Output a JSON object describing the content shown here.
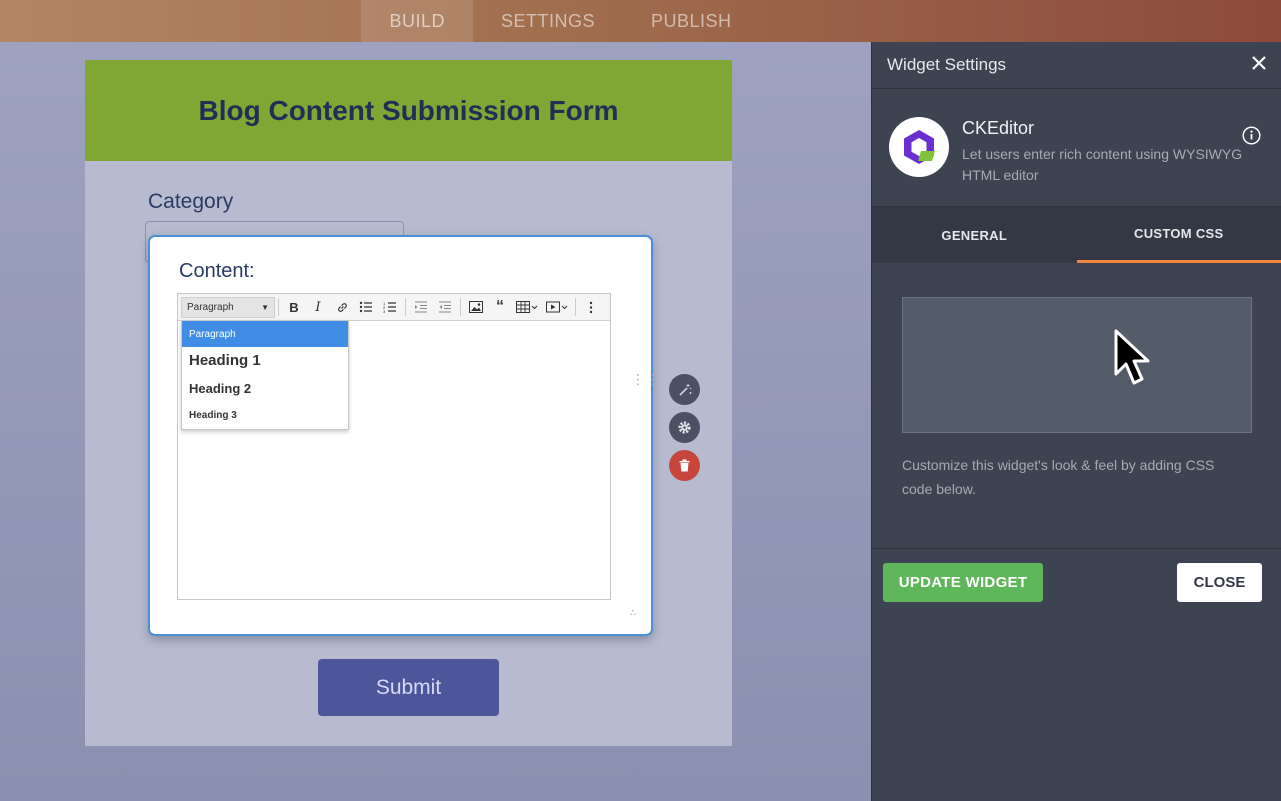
{
  "topbar": {
    "tabs": [
      {
        "label": "BUILD",
        "active": true
      },
      {
        "label": "SETTINGS",
        "active": false
      },
      {
        "label": "PUBLISH",
        "active": false
      }
    ]
  },
  "form": {
    "title": "Blog Content Submission Form",
    "category_label": "Category",
    "content_label": "Content:",
    "submit_label": "Submit",
    "header_color": "#80a634"
  },
  "editor": {
    "format_select": "Paragraph",
    "toolbar_icons": [
      "bold-icon",
      "italic-icon",
      "link-icon",
      "bulleted-list-icon",
      "numbered-list-icon",
      "outdent-icon",
      "indent-icon",
      "image-icon",
      "blockquote-icon",
      "table-icon",
      "media-icon",
      "more-icon"
    ],
    "dropdown": [
      "Paragraph",
      "Heading 1",
      "Heading 2",
      "Heading 3"
    ]
  },
  "panel": {
    "title": "Widget Settings",
    "widget_name": "CKEditor",
    "widget_description": "Let users enter rich content using WYSIWYG HTML editor",
    "tabs": [
      {
        "label": "GENERAL",
        "active": false
      },
      {
        "label": "CUSTOM CSS",
        "active": true
      }
    ],
    "css_value": "",
    "hint": "Customize this widget's look & feel by adding CSS code below.",
    "update_label": "UPDATE WIDGET",
    "close_label": "CLOSE",
    "accent": "#f0853d",
    "update_color": "#60b65b"
  }
}
